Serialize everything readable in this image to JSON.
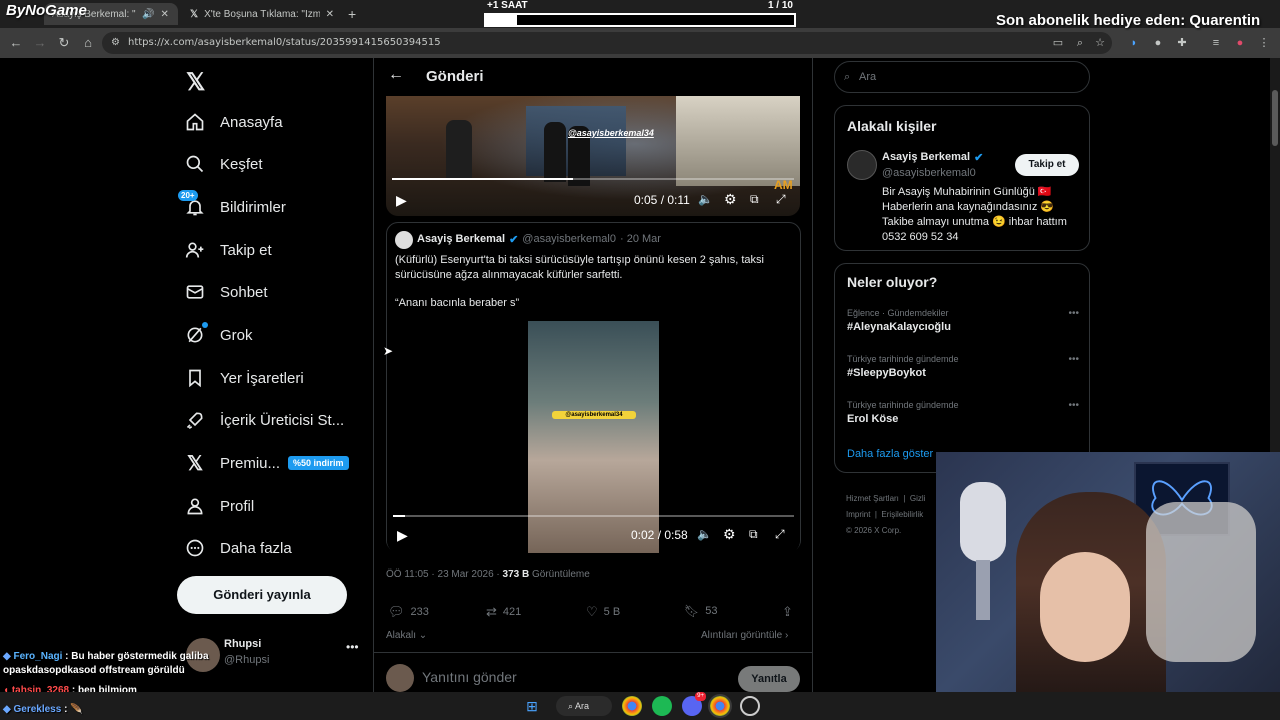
{
  "browser": {
    "tabs": [
      {
        "title": "Asayiş Berkemal: \""
      },
      {
        "title": "X'te Boşuna Tıklama: \"İzmir'de"
      }
    ],
    "new_tab_symbol": "+",
    "url": "https://x.com/asayisberkemal0/status/2035991415650394515"
  },
  "overlay": {
    "logo": "ByNoGame",
    "saat_label": "+1 SAAT",
    "saat_count": "1 / 10",
    "saat_progress": 0.1,
    "sub_gift": "Son abonelik hediye eden: Quarentin"
  },
  "nav": {
    "items": [
      {
        "label": "Anasayfa",
        "icon": "home-icon"
      },
      {
        "label": "Keşfet",
        "icon": "search-icon"
      },
      {
        "label": "Bildirimler",
        "icon": "bell-icon",
        "badge": "20+"
      },
      {
        "label": "Takip et",
        "icon": "follow-icon"
      },
      {
        "label": "Sohbet",
        "icon": "mail-icon"
      },
      {
        "label": "Grok",
        "icon": "grok-icon"
      },
      {
        "label": "Yer İşaretleri",
        "icon": "bookmark-icon"
      },
      {
        "label": "İçerik Üreticisi St...",
        "icon": "rocket-icon"
      },
      {
        "label": "Premiu...",
        "icon": "x-icon",
        "badge": "%50 indirim"
      },
      {
        "label": "Profil",
        "icon": "person-icon"
      },
      {
        "label": "Daha fazla",
        "icon": "more-icon"
      }
    ],
    "post_button": "Gönderi yayınla",
    "account": {
      "name": "Rhupsi",
      "handle": "@Rhupsi"
    }
  },
  "post": {
    "header_title": "Gönderi",
    "video1": {
      "watermark": "@asayisberkemal34",
      "time": "0:05 / 0:11",
      "progress": 0.45,
      "tag": "AM"
    },
    "quote": {
      "author": "Asayiş Berkemal",
      "handle": "@asayisberkemal0",
      "date": "· 20 Mar",
      "text1": "(Küfürlü) Esenyurt'ta bi taksi sürücüsüyle tartışıp önünü kesen 2 şahıs, taksi sürücüsüne ağza alınmayacak küfürler sarfetti.",
      "text2": "“Ananı bacınla beraber s”",
      "video_watermark": "@asayisberkemal34",
      "time": "0:02 / 0:58",
      "progress": 0.03
    },
    "meta_time": "ÖÖ 11:05 · 23 Mar 2026 ·",
    "views_count": "373 B",
    "views_label": "Görüntüleme",
    "stats": {
      "replies": "233",
      "reposts": "421",
      "likes": "5 B",
      "bookmarks": "53"
    },
    "relevant_label": "Alakalı",
    "quotes_link": "Alıntıları görüntüle",
    "reply_placeholder": "Yanıtını gönder",
    "reply_button": "Yanıtla"
  },
  "right": {
    "search_placeholder": "Ara",
    "related_title": "Alakalı kişiler",
    "related": {
      "name": "Asayiş Berkemal",
      "handle": "@asayisberkemal0",
      "follow_button": "Takip et",
      "bio": [
        "Bir Asayiş Muhabirinin Günlüğü 🇹🇷",
        "Haberlerin ana kaynağındasınız 😎",
        "Takibe almayı unutma 😉 ihbar hattım",
        "0532 609 52 34"
      ]
    },
    "trends_title": "Neler oluyor?",
    "trends": [
      {
        "category": "Eğlence · Gündemdekiler",
        "name": "#AleynaKalaycıoğlu"
      },
      {
        "category": "Türkiye tarihinde gündemde",
        "name": "#SleepyBoykot"
      },
      {
        "category": "Türkiye tarihinde gündemde",
        "name": "Erol Köse"
      }
    ],
    "show_more": "Daha fazla göster",
    "footer": [
      "Hizmet Şartları",
      "Gizli",
      "Imprint",
      "Erişilebilirlik",
      "© 2026 X Corp."
    ]
  },
  "chat": [
    {
      "user": "Fero_Nagi",
      "message": "Bu haber göstermedik galiba opaskdasopdkasod offstream görüldü",
      "color": "#5ab4ff"
    },
    {
      "user": "tahsin_3268",
      "message": "ben bilmiom",
      "color": "#ff4b4b"
    },
    {
      "user": "Gerekless",
      "message": "🪶",
      "color": "#6aa8ff"
    }
  ],
  "taskbar": {
    "search": "Ara",
    "discord_badge": "9+"
  },
  "colors": {
    "accent": "#1d9bf0",
    "background": "#000000",
    "border": "#2f3336",
    "muted": "#71767b"
  }
}
